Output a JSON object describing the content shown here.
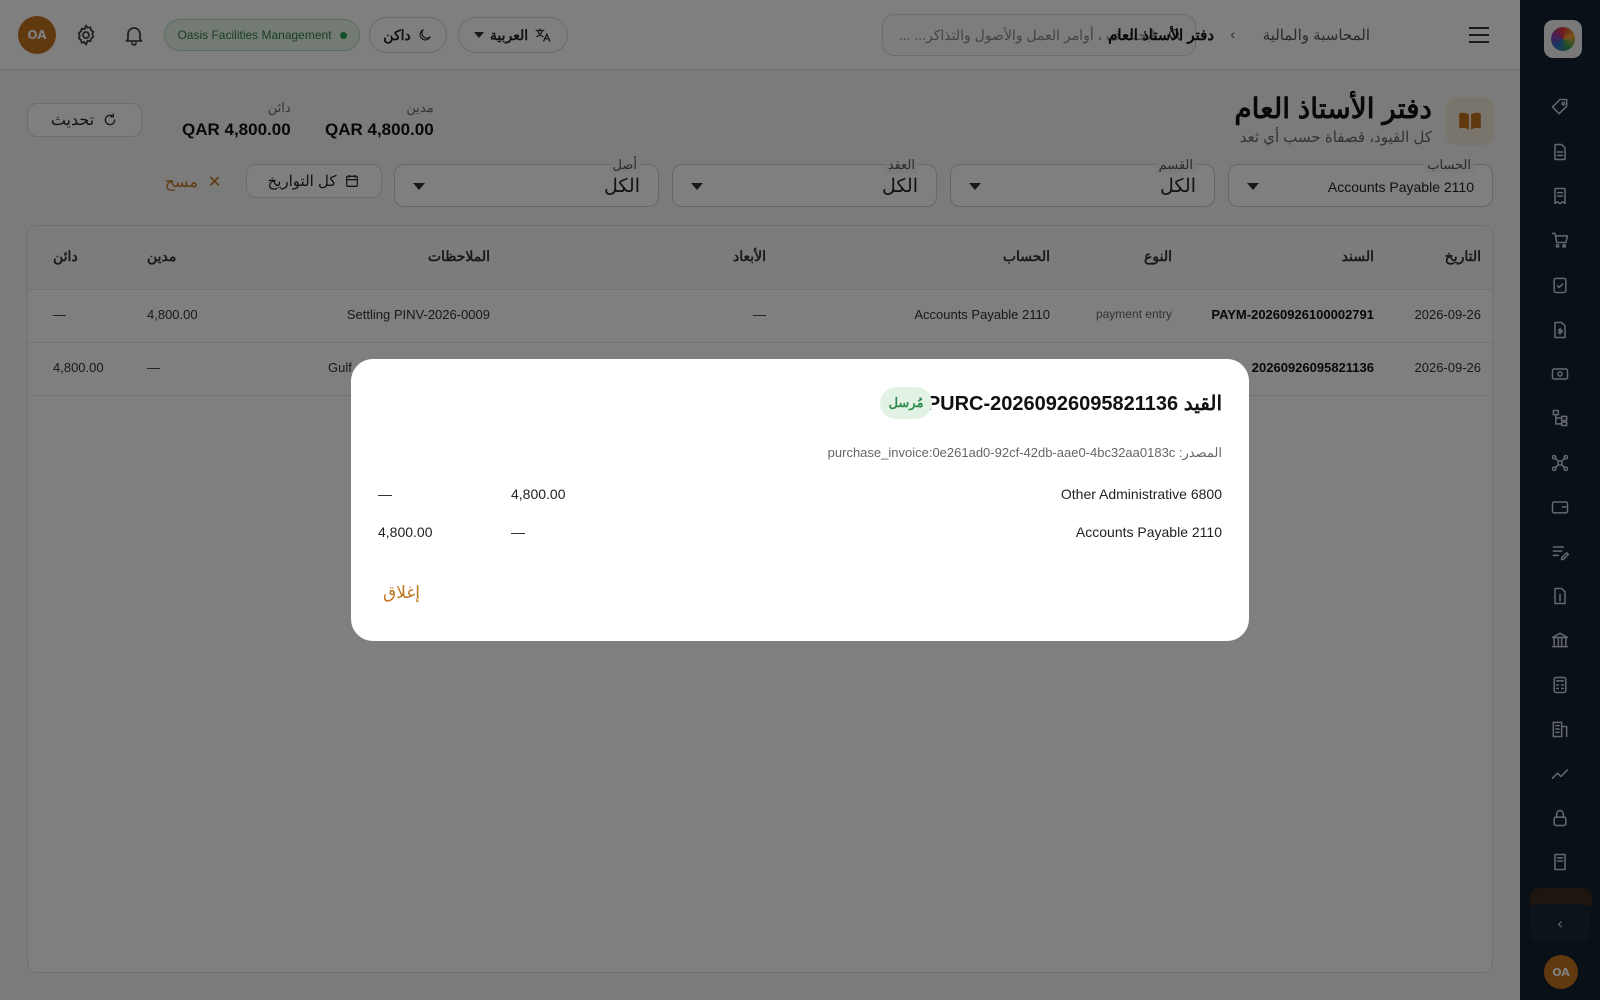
{
  "header": {
    "breadcrumb": [
      "المحاسبة والمالية",
      "دفتر الأستاذ العام"
    ],
    "breadcrumb_sep": "›",
    "search_placeholder": "ابحث ف ، أوامر العمل والأصول والتذاكر... ...",
    "language_label": "العربية",
    "theme_label": "داكن",
    "tenant_name": "Oasis Facilities Management",
    "user_initials": "OA"
  },
  "page": {
    "title": "دفتر الأستاذ العام",
    "subtitle": "كل القيود، قصفاة حسب أي ثعد",
    "totals": {
      "debit_label": "مدين",
      "debit_value": "QAR 4,800.00",
      "credit_label": "دائن",
      "credit_value": "QAR 4,800.00"
    },
    "refresh_label": "تحديث"
  },
  "filters": {
    "account": {
      "label": "الحساب",
      "value": "2110  Accounts Payable"
    },
    "department": {
      "label": "القسم",
      "value": "الكل"
    },
    "contract": {
      "label": "العقد",
      "value": "الكل"
    },
    "asset": {
      "label": "أصل",
      "value": "الكل"
    },
    "date_label": "كل التواريخ",
    "clear_label": "مسح"
  },
  "table": {
    "headers": {
      "date": "التاريخ",
      "document": "السند",
      "type": "النوع",
      "account": "الحساب",
      "dimensions": "الأبعاد",
      "notes": "الملاحظات",
      "debit": "مدين",
      "credit": "دائن"
    },
    "rows": [
      {
        "date": "2026-09-26",
        "document": "PAYM-20260926100002791",
        "type": "payment entry",
        "account": "2110  Accounts Payable",
        "dimensions": "—",
        "notes": "Settling PINV-2026-0009",
        "debit": "4,800.00",
        "credit": "—"
      },
      {
        "date": "2026-09-26",
        "document": "20260926095821136",
        "type": "",
        "account": "",
        "dimensions": "",
        "notes": "Gulf",
        "debit": "—",
        "credit": "4,800.00"
      }
    ]
  },
  "modal": {
    "title": "القيد PURC-20260926095821136",
    "badge": "مُرسل",
    "source": "المصدر: purchase_invoice:0e261ad0-92cf-42db-aae0-4bc32aa0183c",
    "lines": [
      {
        "account": "6800  Other Administrative",
        "debit": "4,800.00",
        "credit": "—"
      },
      {
        "account": "2110  Accounts Payable",
        "debit": "—",
        "credit": "4,800.00"
      }
    ],
    "close_label": "إغلاق"
  },
  "sidebar": {
    "icons": [
      "tag-icon",
      "document-icon",
      "receipt-icon",
      "cart-icon",
      "clipboard-check-icon",
      "invoice-icon",
      "cash-icon",
      "hierarchy-icon",
      "network-icon",
      "wallet-icon",
      "edit-list-icon",
      "dollar-document-icon",
      "bank-icon",
      "calculator-icon",
      "building-icon",
      "chart-line-icon",
      "lock-icon",
      "book-icon"
    ]
  },
  "colors": {
    "accent": "#c0721e",
    "sidebar_bg": "#14202e",
    "status_green": "#2e8b4a"
  }
}
